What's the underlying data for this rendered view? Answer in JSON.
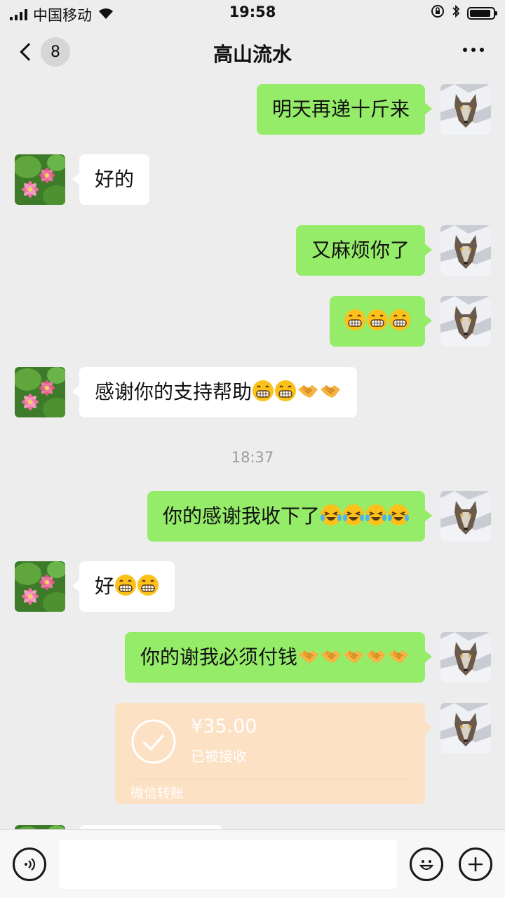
{
  "status_bar": {
    "carrier": "中国移动",
    "time": "19:58",
    "battery_level": 0.9,
    "icons": [
      "signal-icon",
      "wifi-icon",
      "rotation-lock-icon",
      "bluetooth-icon",
      "battery-icon"
    ]
  },
  "nav": {
    "unread_count": "8",
    "title": "高山流水",
    "icons": [
      "back-chevron-icon",
      "more-icon"
    ]
  },
  "messages": [
    {
      "sender": "me",
      "text": "明天再递十斤来",
      "emoji": []
    },
    {
      "sender": "other",
      "text": "好的",
      "emoji": []
    },
    {
      "sender": "me",
      "text": "又麻烦你了",
      "emoji": []
    },
    {
      "sender": "me",
      "text": "",
      "emoji": [
        "grin",
        "grin",
        "grin"
      ]
    },
    {
      "sender": "other",
      "text": "感谢你的支持帮助",
      "emoji": [
        "grin",
        "grin",
        "handshake",
        "handshake"
      ]
    },
    {
      "sender": "me",
      "text": "你的感谢我收下了",
      "emoji": [
        "cry-laugh",
        "cry-laugh",
        "cry-laugh",
        "cry-laugh"
      ]
    },
    {
      "sender": "other",
      "text": "好",
      "emoji": [
        "grin",
        "grin"
      ]
    },
    {
      "sender": "me",
      "text": "你的谢我必须付钱",
      "emoji": [
        "handshake",
        "handshake",
        "handshake",
        "handshake",
        "handshake"
      ]
    }
  ],
  "timestamp": "18:37",
  "transfer": {
    "amount": "¥35.00",
    "status": "已被接收",
    "label": "微信转账",
    "color": "#fde1c4"
  },
  "input_bar": {
    "value": "",
    "icons": [
      "voice-icon",
      "emoji-icon",
      "add-icon"
    ]
  },
  "colors": {
    "my_bubble": "#95ec69",
    "other_bubble": "#ffffff",
    "background": "#ededed"
  }
}
